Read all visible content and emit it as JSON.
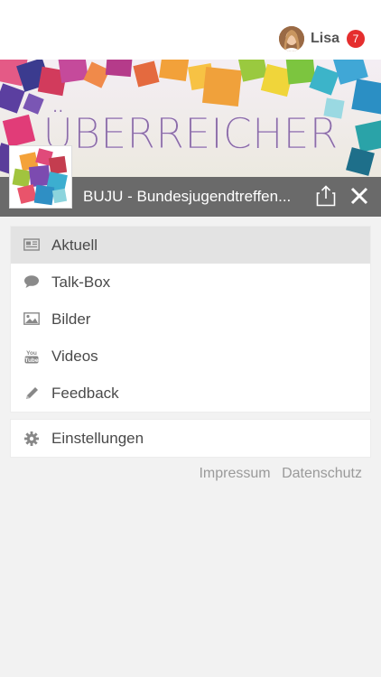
{
  "user": {
    "name": "Lisa",
    "notifications": "7"
  },
  "banner": {
    "title": "ÜBERREICHER"
  },
  "group": {
    "title": "BUJU - Bundesjugendtreffen..."
  },
  "menu": {
    "items": [
      {
        "label": "Aktuell",
        "icon": "newspaper-icon",
        "active": true
      },
      {
        "label": "Talk-Box",
        "icon": "speech-bubble-icon"
      },
      {
        "label": "Bilder",
        "icon": "image-icon"
      },
      {
        "label": "Videos",
        "icon": "youtube-icon"
      },
      {
        "label": "Feedback",
        "icon": "pencil-icon"
      }
    ],
    "settings": {
      "label": "Einstellungen",
      "icon": "gear-icon"
    }
  },
  "footer": {
    "impressum": "Impressum",
    "datenschutz": "Datenschutz"
  },
  "colors": {
    "badge": "#e52e2e",
    "groupbar": "#6a6a6a",
    "active_item": "#e3e3e3",
    "background": "#f2f2f2"
  }
}
